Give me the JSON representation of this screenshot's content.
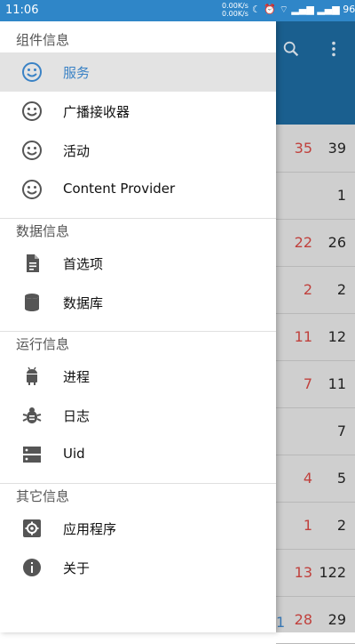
{
  "status_bar": {
    "time": "11:06",
    "speed_up": "0.00K/s",
    "speed_down": "0.00K/s",
    "battery": "96%"
  },
  "drawer": {
    "sections": [
      {
        "header": "组件信息",
        "items": [
          {
            "label": "服务",
            "icon": "smiley-icon",
            "active": true
          },
          {
            "label": "广播接收器",
            "icon": "smiley-icon"
          },
          {
            "label": "活动",
            "icon": "smiley-icon"
          },
          {
            "label": "Content Provider",
            "icon": "smiley-icon"
          }
        ]
      },
      {
        "header": "数据信息",
        "items": [
          {
            "label": "首选项",
            "icon": "document-icon"
          },
          {
            "label": "数据库",
            "icon": "database-icon"
          }
        ]
      },
      {
        "header": "运行信息",
        "items": [
          {
            "label": "进程",
            "icon": "android-icon"
          },
          {
            "label": "日志",
            "icon": "bug-icon"
          },
          {
            "label": "Uid",
            "icon": "server-icon"
          }
        ]
      },
      {
        "header": "其它信息",
        "items": [
          {
            "label": "应用程序",
            "icon": "gear-icon"
          },
          {
            "label": "关于",
            "icon": "info-icon"
          }
        ]
      }
    ]
  },
  "background_list": {
    "rows": [
      {
        "a": "35",
        "b": "39"
      },
      {
        "a": "",
        "b": "1"
      },
      {
        "a": "22",
        "b": "26"
      },
      {
        "a": "2",
        "b": "2"
      },
      {
        "a": "11",
        "b": "12"
      },
      {
        "a": "7",
        "b": "11"
      },
      {
        "a": "",
        "b": "7"
      },
      {
        "a": "4",
        "b": "5"
      },
      {
        "a": "1",
        "b": "2"
      },
      {
        "a": "13",
        "b": "122"
      },
      {
        "a": "28",
        "b": "29"
      }
    ],
    "tail_left": "1"
  },
  "colors": {
    "accent": "#3a82c5",
    "statusbar": "#2f86c8",
    "appbar": "#1a5f8f",
    "count_red": "#c0413d"
  }
}
